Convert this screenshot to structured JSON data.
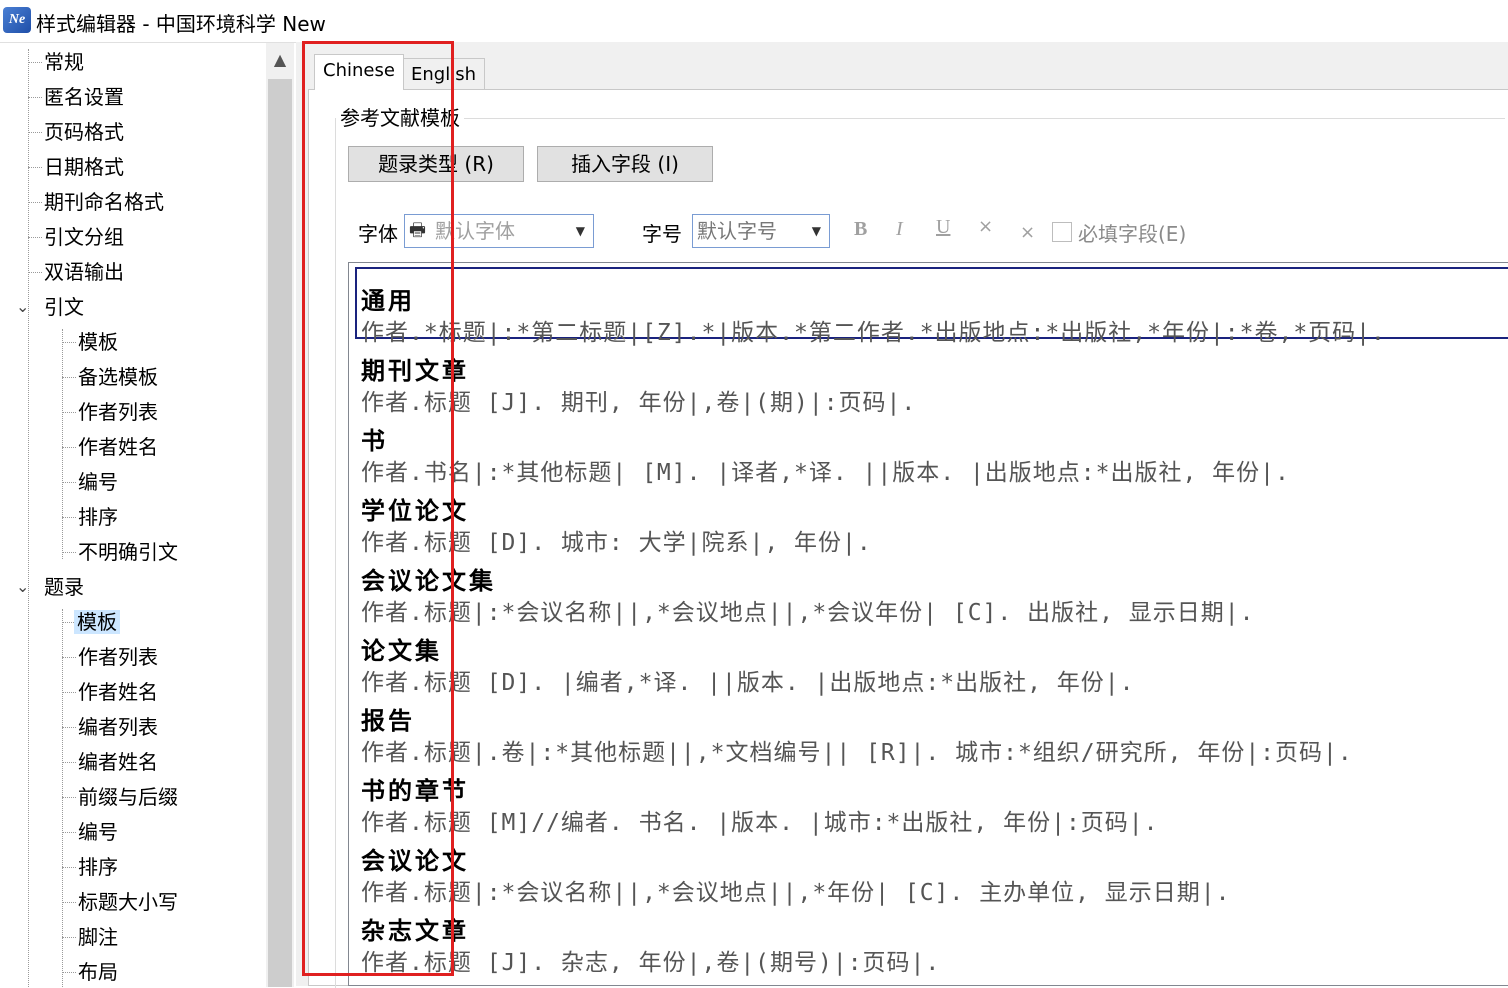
{
  "window": {
    "title": "样式编辑器 - 中国环境科学 New",
    "icon_text": "Ne"
  },
  "sidebar": {
    "items": [
      {
        "label": "常规"
      },
      {
        "label": "匿名设置"
      },
      {
        "label": "页码格式"
      },
      {
        "label": "日期格式"
      },
      {
        "label": "期刊命名格式"
      },
      {
        "label": "引文分组"
      },
      {
        "label": "双语输出"
      },
      {
        "label": "引文"
      },
      {
        "label": "模板"
      },
      {
        "label": "备选模板"
      },
      {
        "label": "作者列表"
      },
      {
        "label": "作者姓名"
      },
      {
        "label": "编号"
      },
      {
        "label": "排序"
      },
      {
        "label": "不明确引文"
      },
      {
        "label": "题录"
      },
      {
        "label": "模板"
      },
      {
        "label": "作者列表"
      },
      {
        "label": "作者姓名"
      },
      {
        "label": "编者列表"
      },
      {
        "label": "编者姓名"
      },
      {
        "label": "前缀与后缀"
      },
      {
        "label": "编号"
      },
      {
        "label": "排序"
      },
      {
        "label": "标题大小写"
      },
      {
        "label": "脚注"
      },
      {
        "label": "布局"
      }
    ]
  },
  "tabs": [
    {
      "label": "Chinese"
    },
    {
      "label": "English"
    }
  ],
  "group": {
    "title": "参考文献模板"
  },
  "buttons": {
    "ref_type": "题录类型 (R)",
    "insert_field": "插入字段 (I)"
  },
  "format": {
    "font_label": "字体",
    "font_value": "默认字体",
    "size_label": "字号",
    "size_value": "默认字号",
    "bold": "B",
    "italic": "I",
    "underline": "U",
    "sup": "×",
    "sub": "×",
    "required_label": "必填字段(E)"
  },
  "templates": [
    {
      "title": "通用",
      "body": "作者.*标题|:*第二标题|[Z].*|版本.*第二作者.*出版地点:*出版社,*年份|:*卷,*页码|."
    },
    {
      "title": "期刊文章",
      "body": "作者.标题 [J]. 期刊, 年份|,卷|(期)|:页码|."
    },
    {
      "title": "书",
      "body": "作者.书名|:*其他标题| [M]. |译者,*译. ||版本. |出版地点:*出版社, 年份|."
    },
    {
      "title": "学位论文",
      "body": "作者.标题 [D]. 城市: 大学|院系|, 年份|."
    },
    {
      "title": "会议论文集",
      "body": "作者.标题|:*会议名称||,*会议地点||,*会议年份| [C]. 出版社, 显示日期|."
    },
    {
      "title": "论文集",
      "body": "作者.标题 [D]. |编者,*译. ||版本. |出版地点:*出版社, 年份|."
    },
    {
      "title": "报告",
      "body": "作者.标题|.卷|:*其他标题||,*文档编号|| [R]|. 城市:*组织/研究所, 年份|:页码|."
    },
    {
      "title": "书的章节",
      "body": "作者.标题 [M]//编者. 书名. |版本. |城市:*出版社, 年份|:页码|."
    },
    {
      "title": "会议论文",
      "body": "作者.标题|:*会议名称||,*会议地点||,*年份| [C]. 主办单位, 显示日期|."
    },
    {
      "title": "杂志文章",
      "body": "作者.标题 [J]. 杂志, 年份|,卷|(期号)|:页码|."
    }
  ]
}
